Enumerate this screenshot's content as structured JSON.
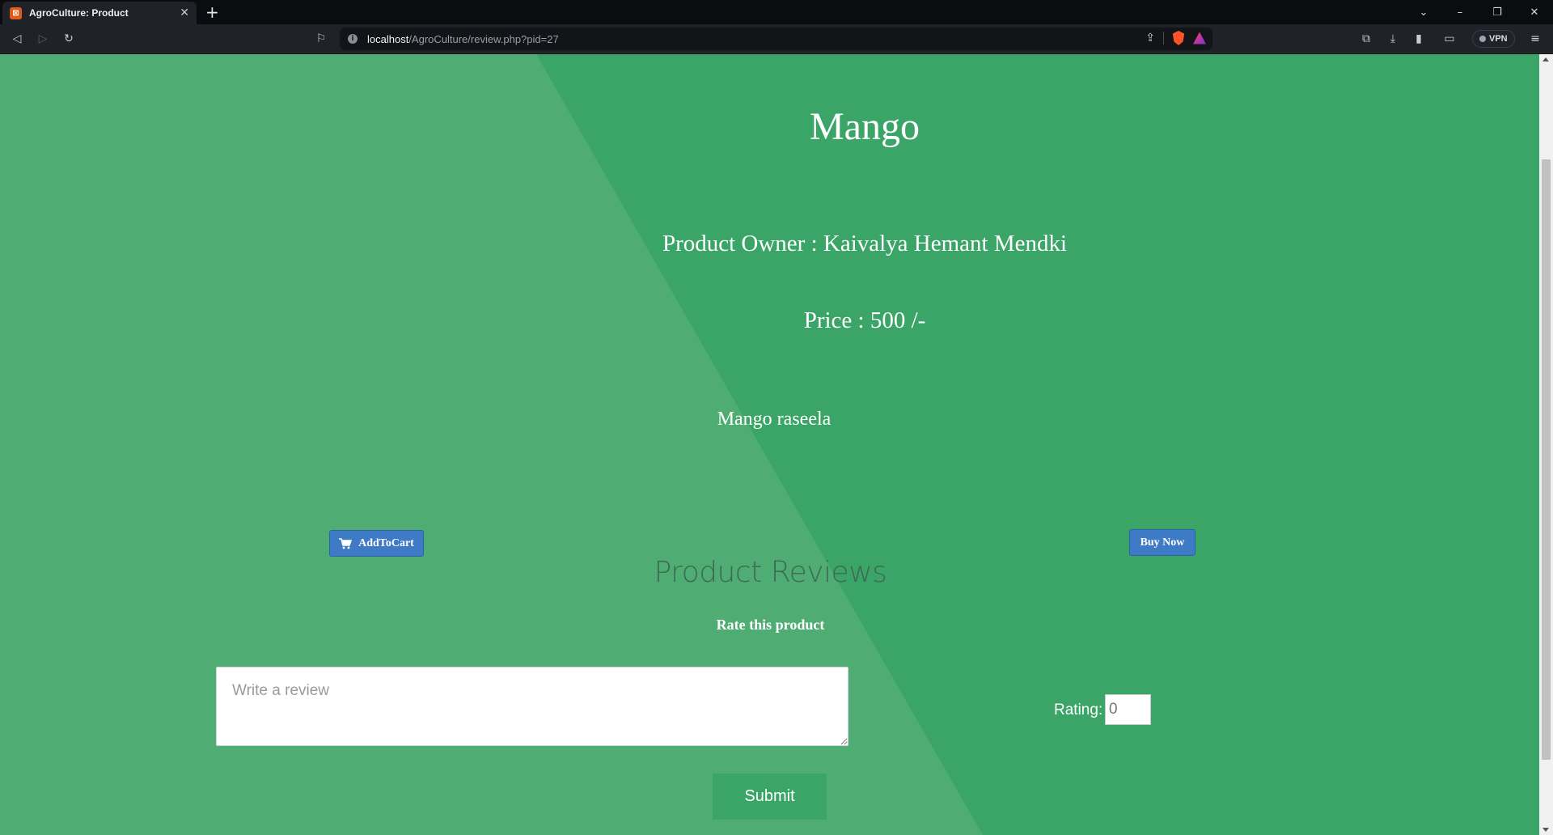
{
  "browser": {
    "tab_title": "AgroCulture: Product",
    "tab_favicon": "xampp-icon",
    "url_host": "localhost",
    "url_path": "/AgroCulture/review.php?pid=27",
    "vpn_label": "VPN"
  },
  "product": {
    "name": "Mango",
    "owner": "Product Owner : Kaivalya Hemant Mendki",
    "price": "Price : 500 /-",
    "description": "Mango raseela"
  },
  "actions": {
    "add_to_cart_label": "AddToCart",
    "buy_now_label": "Buy Now"
  },
  "reviews": {
    "title": "Product Reviews",
    "rate_label": "Rate this product",
    "review_placeholder": "Write a review",
    "rating_label": "Rating:",
    "rating_value": "0",
    "submit_label": "Submit"
  },
  "colors": {
    "page_green": "#3ba568",
    "page_green_light": "#4fad73",
    "button_blue": "#3f7ac7"
  }
}
